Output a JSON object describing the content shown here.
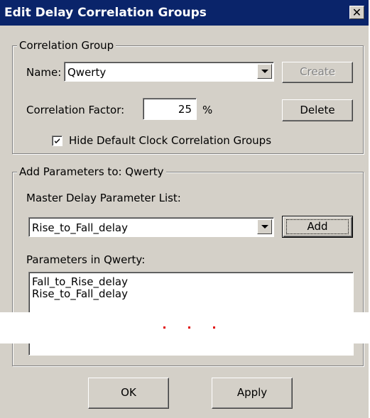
{
  "window": {
    "title": "Edit Delay Correlation Groups",
    "close_glyph": "✕"
  },
  "correlation_group": {
    "legend": "Correlation Group",
    "name_label": "Name:",
    "name_value": "Qwerty",
    "create_label": "Create",
    "factor_label": "Correlation Factor:",
    "factor_value": "25",
    "factor_unit": "%",
    "delete_label": "Delete",
    "hide_default_label": "Hide Default Clock Correlation Groups",
    "hide_default_checked": true
  },
  "add_parameters": {
    "legend": "Add Parameters to: Qwerty",
    "master_list_label": "Master Delay Parameter List:",
    "master_selected": "Rise_to_Fall_delay",
    "add_label": "Add",
    "params_label": "Parameters in Qwerty:",
    "params": [
      "Fall_to_Rise_delay",
      "Rise_to_Fall_delay"
    ]
  },
  "footer": {
    "ok_label": "OK",
    "apply_label": "Apply"
  },
  "colors": {
    "title_bar": "#0a246a",
    "dialog_face": "#d4d0c8",
    "marker_dots": "#e00000"
  }
}
